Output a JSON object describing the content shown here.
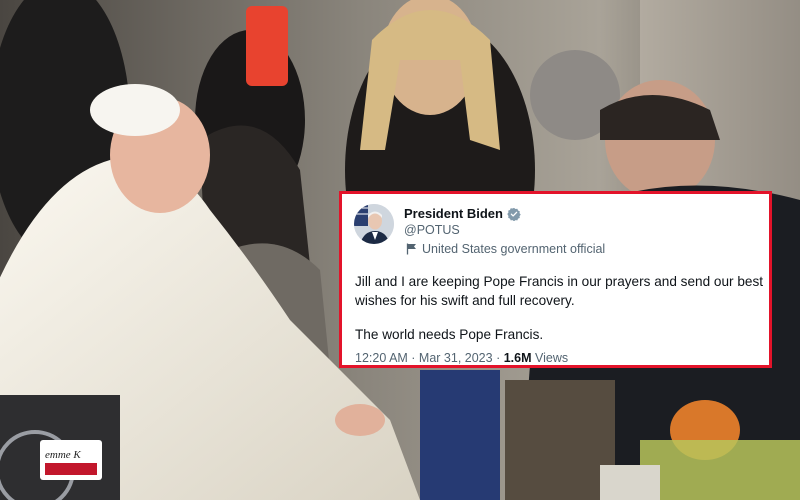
{
  "tweet": {
    "display_name": "President Biden",
    "handle": "@POTUS",
    "affiliation": "United States government official",
    "text_paragraph_1": "Jill and I are keeping Pope Francis in our prayers and send our best wishes for his swift and full recovery.",
    "text_paragraph_2": "The world needs Pope Francis.",
    "timestamp": "12:20 AM · Mar 31, 2023",
    "separator": " · ",
    "views_count": "1.6M",
    "views_label": " Views",
    "verified_icon": "verified-badge-icon",
    "affiliation_icon": "flag-icon",
    "border_color": "#e3132a",
    "verified_color": "#829aab"
  },
  "photo": {
    "wheelchair_sticker_text": "emme K"
  }
}
